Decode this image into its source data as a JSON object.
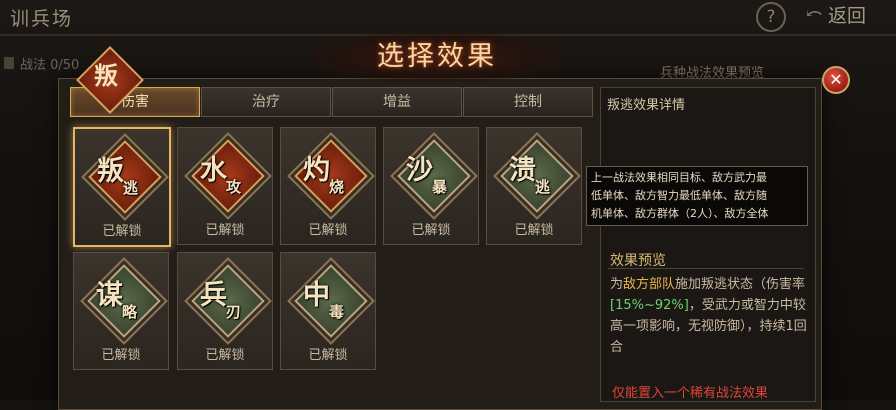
{
  "background": {
    "title": "训兵场",
    "count": "战法 0/50",
    "preview_label": "兵种战法效果预览",
    "help": "?",
    "back": "返回"
  },
  "dialog": {
    "title": "选择效果",
    "close": "✕",
    "tabs": [
      {
        "label": "伤害",
        "active": true
      },
      {
        "label": "治疗",
        "active": false
      },
      {
        "label": "增益",
        "active": false
      },
      {
        "label": "控制",
        "active": false
      }
    ],
    "cards": [
      {
        "g1": "叛",
        "g2": "逃",
        "status": "已解锁",
        "style": "red",
        "selected": true
      },
      {
        "g1": "水",
        "g2": "攻",
        "status": "已解锁",
        "style": "red",
        "selected": false
      },
      {
        "g1": "灼",
        "g2": "烧",
        "status": "已解锁",
        "style": "red",
        "selected": false
      },
      {
        "g1": "沙",
        "g2": "暴",
        "status": "已解锁",
        "style": "green",
        "selected": false
      },
      {
        "g1": "溃",
        "g2": "逃",
        "status": "已解锁",
        "style": "green",
        "selected": false
      },
      {
        "g1": "谋",
        "g2": "略",
        "status": "已解锁",
        "style": "green",
        "selected": false
      },
      {
        "g1": "兵",
        "g2": "刃",
        "status": "已解锁",
        "style": "green",
        "selected": false
      },
      {
        "g1": "中",
        "g2": "毒",
        "status": "已解锁",
        "style": "green",
        "selected": false
      }
    ],
    "detail": {
      "title": "叛逃效果详情",
      "emblem_char": "叛",
      "tooltip_lines": [
        "上一战法效果相同目标、敌方武力最",
        "低单体、敌方智力最低单体、敌方随",
        "机单体、敌方群体（2人）、敌方全体"
      ],
      "preview_title": "效果预览",
      "desc_prefix": "为",
      "desc_target": "敌方部队",
      "desc_mid": "施加叛逃状态（伤害率",
      "desc_rate": "[15%~92%]",
      "desc_suffix": "，受武力或智力中较高一项影响，无视防御），持续1回合",
      "note": "仅能置入一个稀有战法效果"
    }
  }
}
